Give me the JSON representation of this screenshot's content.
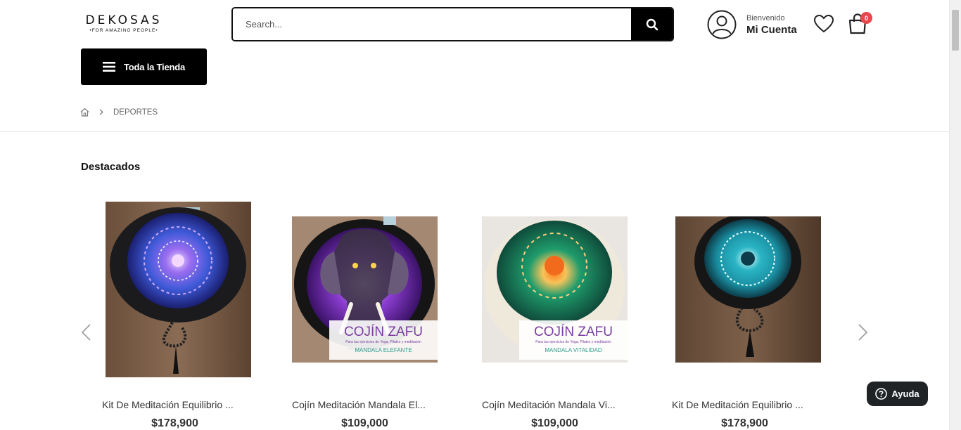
{
  "brand": {
    "name": "DEKOSAS",
    "tagline": "•FOR AMAZING PEOPLE•"
  },
  "search": {
    "placeholder": "Search...",
    "icon": "search-icon"
  },
  "account": {
    "welcome": "Bienvenido",
    "name": "Mi Cuenta",
    "icon": "user-icon"
  },
  "wishlist": {
    "icon": "heart-icon"
  },
  "cart": {
    "count": "0",
    "icon": "shopping-bag-icon"
  },
  "nav": {
    "store_label": "Toda la Tienda",
    "icon": "menu-icon"
  },
  "breadcrumb": {
    "home_icon": "home-icon",
    "current": "DEPORTES"
  },
  "section": {
    "title": "Destacados"
  },
  "products": [
    {
      "name": "Kit De Meditación Equilibrio ...",
      "price": "$178,900"
    },
    {
      "name": "Cojín Meditación Mandala El...",
      "price": "$109,000",
      "overlay_title": "COJÍN ZAFU",
      "overlay_sub": "Para tus ejercicios de Yoga, Pilates y meditación",
      "overlay_name": "MANDALA ELEFANTE"
    },
    {
      "name": "Cojín Meditación Mandala Vi...",
      "price": "$109,000",
      "overlay_title": "COJÍN ZAFU",
      "overlay_sub": "Para tus ejercicios de Yoga, Pilates y meditación",
      "overlay_name": "MANDALA VITALIDAD"
    },
    {
      "name": "Kit De Meditación Equilibrio ...",
      "price": "$178,900"
    }
  ],
  "help": {
    "label": "Ayuda",
    "icon": "question-circle-icon"
  },
  "colors": {
    "accent": "#000000",
    "badge": "#e8474c",
    "overlay_text": "#7b3fa0"
  }
}
